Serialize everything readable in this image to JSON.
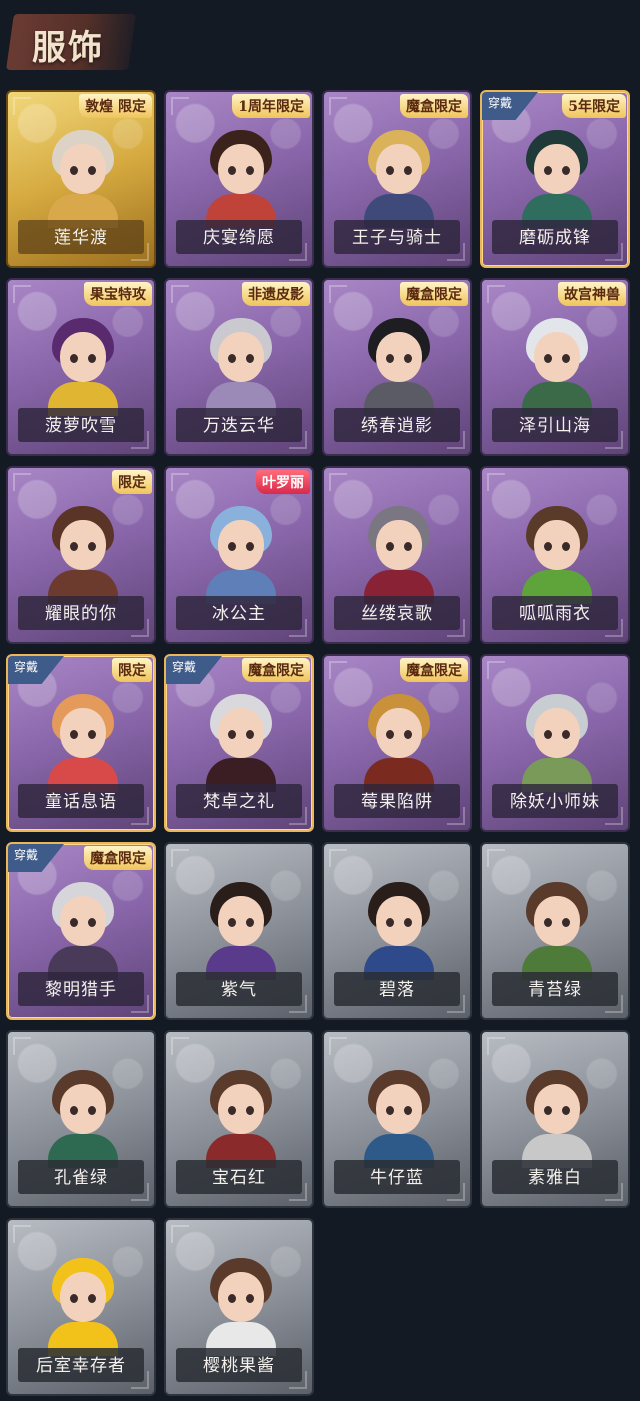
{
  "page_title": "服饰",
  "colors": {
    "background": "#141a24",
    "title_banner": "#6a3b33",
    "card_purple": "#8a67ab",
    "card_gold": "#d5a93f",
    "card_grey": "#8c919a"
  },
  "costumes": [
    {
      "name": "莲华渡",
      "tier": "gold",
      "tag": "敦煌 限定",
      "worn": false,
      "hair": "#dcd3c6",
      "outfit": "#d9a84a"
    },
    {
      "name": "庆宴绮愿",
      "tier": "purple",
      "tag": "1周年限定",
      "worn": false,
      "hair": "#3b231c",
      "outfit": "#c0433a"
    },
    {
      "name": "王子与骑士",
      "tier": "purple",
      "tag": "魔盒限定",
      "worn": false,
      "hair": "#d9b25a",
      "outfit": "#3d4a7a"
    },
    {
      "name": "磨砺成锋",
      "tier": "purple",
      "tag": "5年限定",
      "worn": true,
      "worn_label": "穿戴",
      "hair": "#1f3a38",
      "outfit": "#2f6d5e"
    },
    {
      "name": "菠萝吹雪",
      "tier": "purple",
      "tag": "果宝特攻",
      "worn": false,
      "hair": "#5a2a6e",
      "outfit": "#e0b532"
    },
    {
      "name": "万迭云华",
      "tier": "purple",
      "tag": "非遗皮影",
      "worn": false,
      "hair": "#c9c9cf",
      "outfit": "#9b8ab8"
    },
    {
      "name": "绣春逍影",
      "tier": "purple",
      "tag": "魔盒限定",
      "worn": false,
      "hair": "#1d1d22",
      "outfit": "#5b5b66"
    },
    {
      "name": "泽引山海",
      "tier": "purple",
      "tag": "故宫神兽",
      "worn": false,
      "hair": "#e2e6ea",
      "outfit": "#3b6a49"
    },
    {
      "name": "耀眼的你",
      "tier": "purple",
      "tag": "限定",
      "worn": false,
      "hair": "#5a3426",
      "outfit": "#6d3a2e"
    },
    {
      "name": "冰公主",
      "tier": "purple",
      "tag": "叶罗丽",
      "tag_style": "red",
      "worn": false,
      "hair": "#8ab1dc",
      "outfit": "#5f7fb8"
    },
    {
      "name": "丝缕哀歌",
      "tier": "purple",
      "tag": "",
      "worn": false,
      "hair": "#7a7682",
      "outfit": "#8a2236"
    },
    {
      "name": "呱呱雨衣",
      "tier": "purple",
      "tag": "",
      "worn": false,
      "hair": "#5a3a28",
      "outfit": "#5ea43a"
    },
    {
      "name": "童话息语",
      "tier": "purple",
      "tag": "限定",
      "worn": true,
      "worn_label": "穿戴",
      "hair": "#e39a5a",
      "outfit": "#d84a4a"
    },
    {
      "name": "梵卓之礼",
      "tier": "purple",
      "tag": "魔盒限定",
      "worn": true,
      "worn_label": "穿戴",
      "hair": "#d9d9dd",
      "outfit": "#3a1e24"
    },
    {
      "name": "莓果陷阱",
      "tier": "purple",
      "tag": "魔盒限定",
      "worn": false,
      "hair": "#c8913a",
      "outfit": "#7a2a1e"
    },
    {
      "name": "除妖小师妹",
      "tier": "purple",
      "tag": "",
      "worn": false,
      "hair": "#c7cdd0",
      "outfit": "#7a9a5a"
    },
    {
      "name": "黎明猎手",
      "tier": "purple",
      "tag": "魔盒限定",
      "worn": true,
      "worn_label": "穿戴",
      "hair": "#d5d5da",
      "outfit": "#4a3a5a"
    },
    {
      "name": "紫气",
      "tier": "grey",
      "tag": "",
      "worn": false,
      "hair": "#2a1e1a",
      "outfit": "#5a3a8a"
    },
    {
      "name": "碧落",
      "tier": "grey",
      "tag": "",
      "worn": false,
      "hair": "#2a1e1a",
      "outfit": "#2e4a8a"
    },
    {
      "name": "青苔绿",
      "tier": "grey",
      "tag": "",
      "worn": false,
      "hair": "#5a3a2a",
      "outfit": "#4e7a3a"
    },
    {
      "name": "孔雀绿",
      "tier": "grey",
      "tag": "",
      "worn": false,
      "hair": "#5a3a2a",
      "outfit": "#2e6a52"
    },
    {
      "name": "宝石红",
      "tier": "grey",
      "tag": "",
      "worn": false,
      "hair": "#5a3a2a",
      "outfit": "#8a2a2a"
    },
    {
      "name": "牛仔蓝",
      "tier": "grey",
      "tag": "",
      "worn": false,
      "hair": "#5a3a2a",
      "outfit": "#2e5a8a"
    },
    {
      "name": "素雅白",
      "tier": "grey",
      "tag": "",
      "worn": false,
      "hair": "#5a3a2a",
      "outfit": "#c8c8c8"
    },
    {
      "name": "后室幸存者",
      "tier": "grey",
      "tag": "",
      "worn": false,
      "hair": "#f2c21a",
      "outfit": "#f2c21a"
    },
    {
      "name": "樱桃果酱",
      "tier": "grey",
      "tag": "",
      "worn": false,
      "hair": "#5a3a2a",
      "outfit": "#e8e8e8"
    }
  ]
}
